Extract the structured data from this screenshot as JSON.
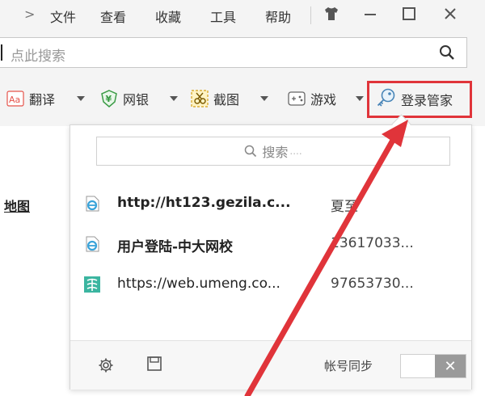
{
  "menu": {
    "chevron": ">",
    "items": [
      "文件",
      "查看",
      "收藏",
      "工具",
      "帮助"
    ]
  },
  "window_controls": [
    "skin-icon",
    "minimize-icon",
    "maximize-icon",
    "close-icon"
  ],
  "search": {
    "placeholder": "点此搜索"
  },
  "toolbar": {
    "items": [
      {
        "label": "翻译",
        "icon": "translate-icon",
        "icon_text": "Aa"
      },
      {
        "label": "网银",
        "icon": "bank-icon",
        "icon_text": "¥"
      },
      {
        "label": "截图",
        "icon": "screenshot-icon"
      },
      {
        "label": "游戏",
        "icon": "game-icon"
      }
    ],
    "login_manager": {
      "label": "登录管家",
      "icon": "key-icon",
      "highlight_color": "#e0343a"
    }
  },
  "page": {
    "link_left": "地图"
  },
  "popup": {
    "search_label": "搜索",
    "search_dots": "....",
    "accounts": [
      {
        "site": "http://ht123.gezila.c...",
        "user": "夏至",
        "icon": "ie-icon",
        "bold": true
      },
      {
        "site": "用户登陆-中大网校",
        "user": "13617033...",
        "icon": "ie-icon",
        "bold": true
      },
      {
        "site": "https://web.umeng.co...",
        "user": "97653730...",
        "icon": "umeng-icon",
        "bold": false
      }
    ],
    "footer": {
      "settings_icon": "gear-icon",
      "save_icon": "save-icon",
      "sync_label": "帐号同步",
      "toggle_state": "off"
    }
  }
}
